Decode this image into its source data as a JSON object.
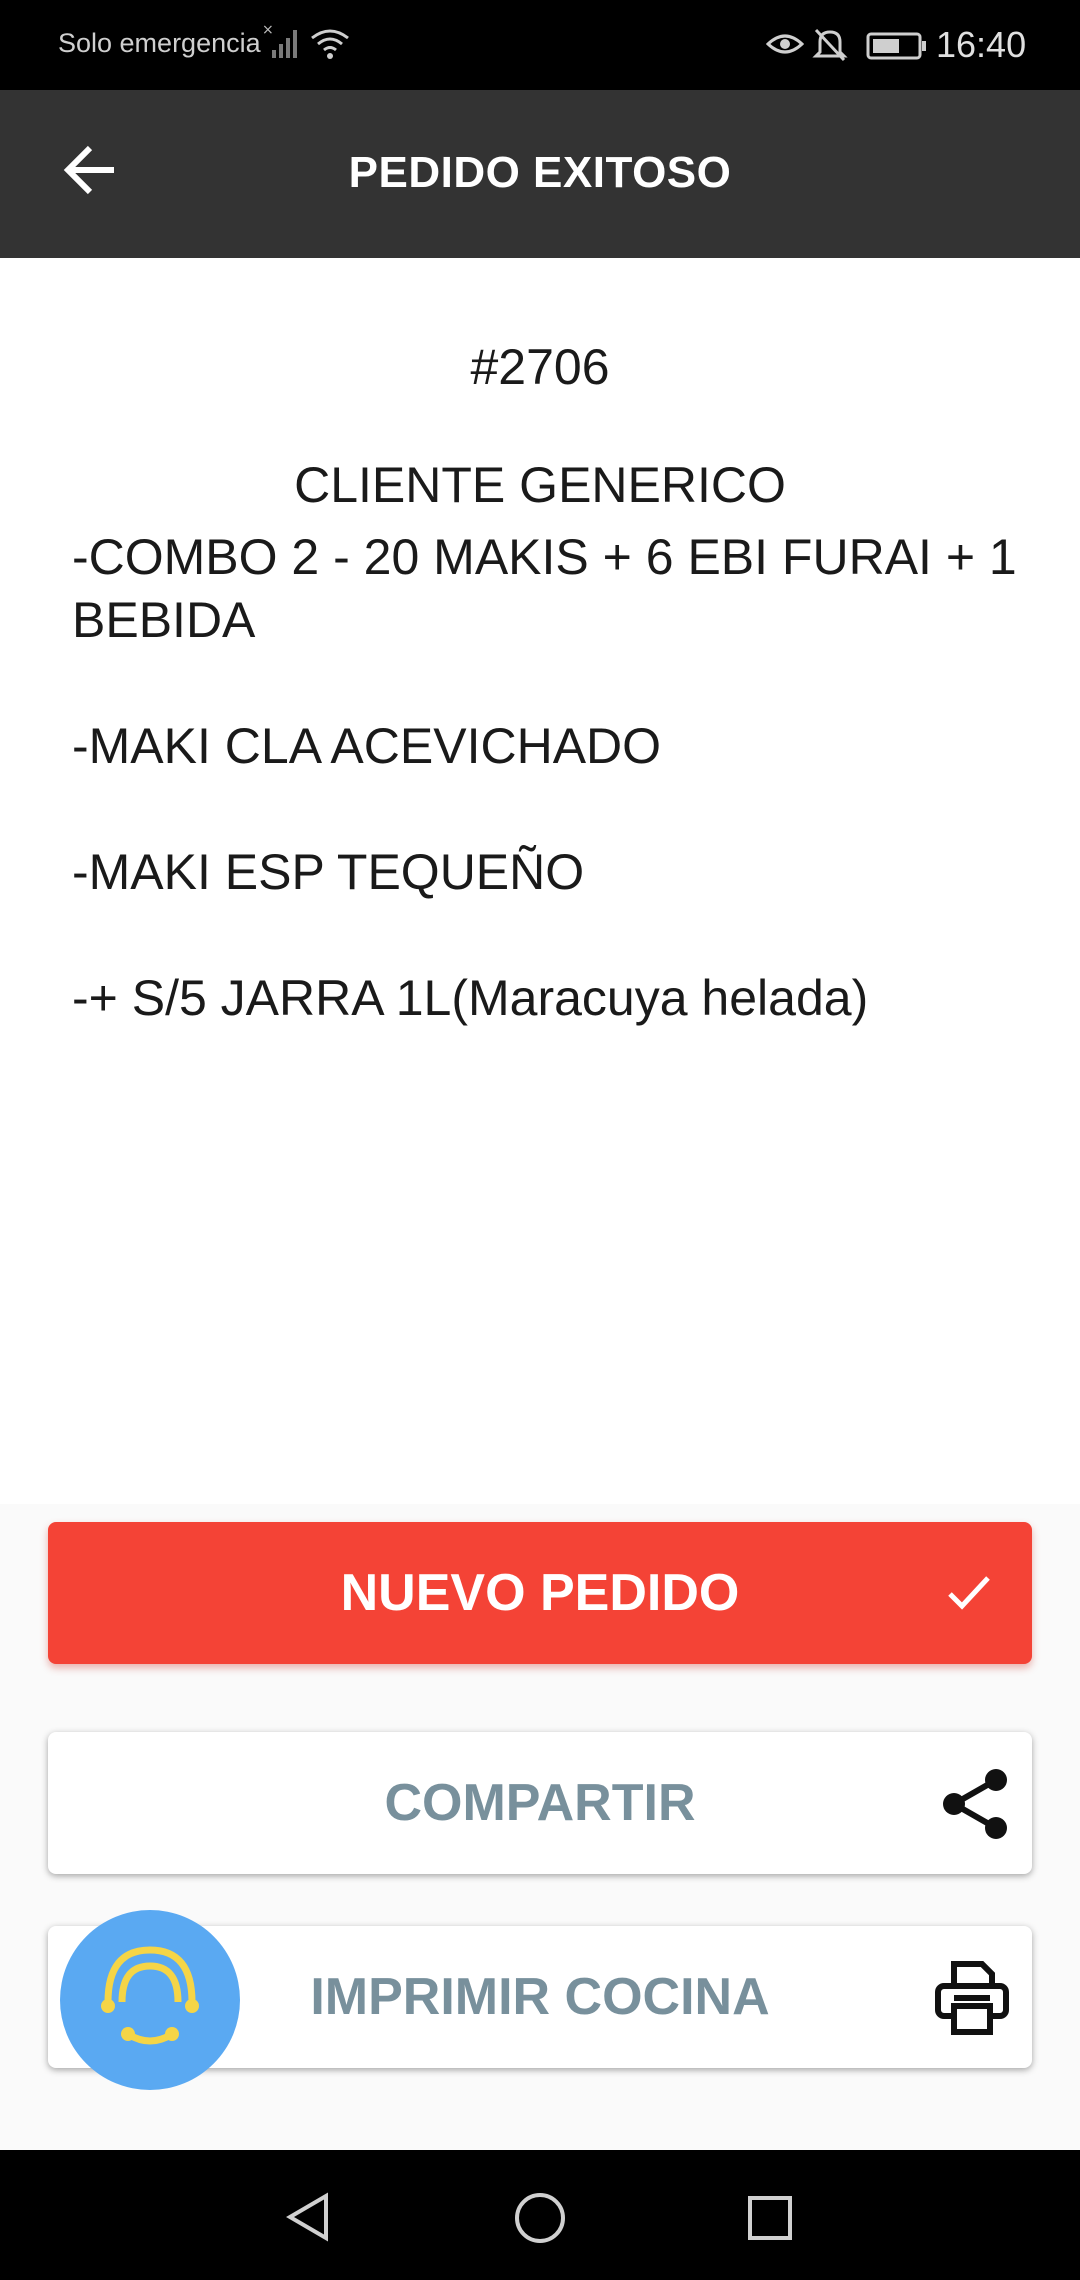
{
  "status_bar": {
    "carrier": "Solo emergencia",
    "time": "16:40"
  },
  "app_bar": {
    "title": "PEDIDO EXITOSO",
    "back_icon": "arrow-back-icon"
  },
  "order": {
    "number": "#2706",
    "customer": "CLIENTE GENERICO",
    "items": [
      "-COMBO 2 - 20 MAKIS + 6 EBI FURAI + 1 BEBIDA",
      "-MAKI CLA ACEVICHADO",
      "-MAKI ESP TEQUEÑO",
      "-+ S/5 JARRA 1L(Maracuya helada)"
    ]
  },
  "actions": {
    "new_order": {
      "label": "NUEVO PEDIDO",
      "icon": "check-icon"
    },
    "share": {
      "label": "COMPARTIR",
      "icon": "share-icon"
    },
    "print_kitchen": {
      "label": "IMPRIMIR COCINA",
      "icon": "printer-icon"
    }
  },
  "colors": {
    "app_bar": "#333333",
    "primary_button": "#f44336",
    "secondary_text": "#78909c",
    "fab": "#5aa9f2",
    "fab_logo": "#f5d547"
  }
}
